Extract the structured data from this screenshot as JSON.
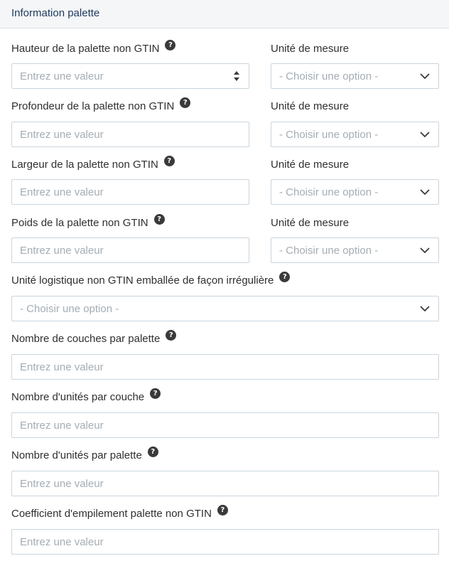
{
  "header": {
    "title": "Information palette"
  },
  "placeholders": {
    "input": "Entrez une valeur",
    "select": "- Choisir une option -"
  },
  "rows": [
    {
      "label": "Hauteur de la palette non GTIN",
      "unit_label": "Unité de mesure"
    },
    {
      "label": "Profondeur de la palette non GTIN",
      "unit_label": "Unité de mesure"
    },
    {
      "label": "Largeur de la palette non GTIN",
      "unit_label": "Unité de mesure"
    },
    {
      "label": "Poids de la palette non GTIN",
      "unit_label": "Unité de mesure"
    }
  ],
  "irregular": {
    "label": "Unité logistique non GTIN emballée de façon irrégulière"
  },
  "layers_per_pallet": {
    "label": "Nombre de couches par palette"
  },
  "units_per_layer": {
    "label": "Nombre d'unités par couche"
  },
  "units_per_pallet": {
    "label": "Nombre d'unités par palette"
  },
  "stacking_coefficient": {
    "label": "Coefficient d'empilement palette non GTIN"
  },
  "icons": {
    "help": "question-mark-icon",
    "select": "chevron-down-icon",
    "stepper": "stepper-arrows-icon"
  },
  "help_glyph": "?",
  "colors": {
    "header_bg": "#f4f6f8",
    "title": "#1f3a5c",
    "border": "#c9d5de",
    "placeholder": "#a3adb5",
    "help_bg": "#3a3a3a"
  }
}
